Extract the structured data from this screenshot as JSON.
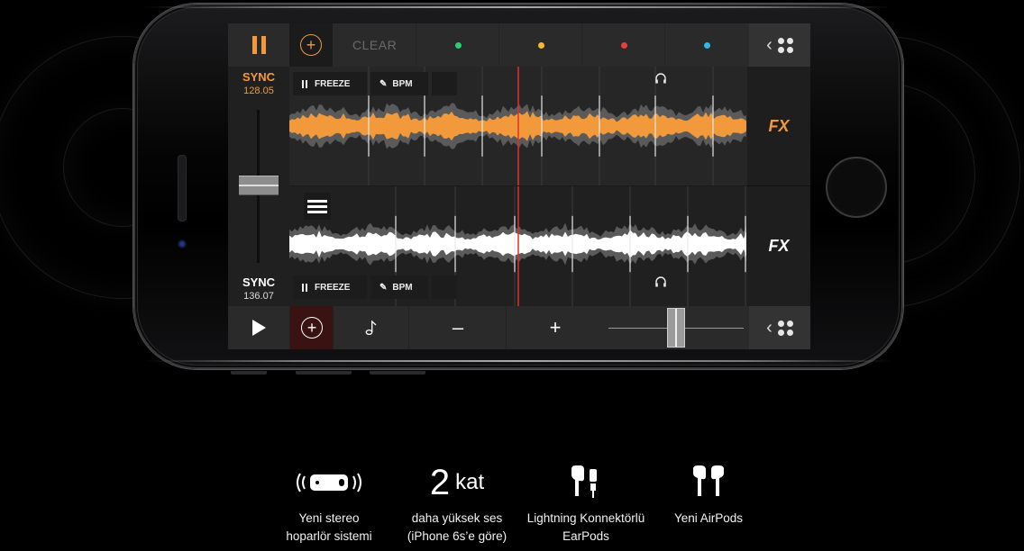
{
  "app": {
    "top_bar": {
      "clear_label": "CLEAR",
      "cue_colors": [
        "#2ecc71",
        "#f5b82e",
        "#e0413a",
        "#35b7e6"
      ]
    },
    "deck_a": {
      "sync_label": "SYNC",
      "bpm": "128.05",
      "freeze_label": "FREEZE",
      "bpm_label": "BPM",
      "fx_label": "FX",
      "waveform_color": "#f29a3b"
    },
    "deck_b": {
      "sync_label": "SYNC",
      "bpm": "136.07",
      "freeze_label": "FREEZE",
      "bpm_label": "BPM",
      "fx_label": "FX",
      "waveform_color": "#ffffff"
    },
    "bottom_bar": {
      "minus_label": "–",
      "plus_label": "+"
    },
    "colors": {
      "accent": "#f29a3b",
      "playhead": "#e0302a"
    }
  },
  "features": [
    {
      "icon": "speaker-phone-icon",
      "line1": "Yeni stereo",
      "line2": "hoparlör sistemi"
    },
    {
      "big_number": "2",
      "big_unit": "kat",
      "line1": "daha yüksek ses",
      "line2": "(iPhone 6s’e göre)"
    },
    {
      "icon": "lightning-earpods-icon",
      "line1": "Lightning Konnektörlü",
      "line2": "EarPods"
    },
    {
      "icon": "airpods-icon",
      "line1": "Yeni AirPods"
    }
  ]
}
